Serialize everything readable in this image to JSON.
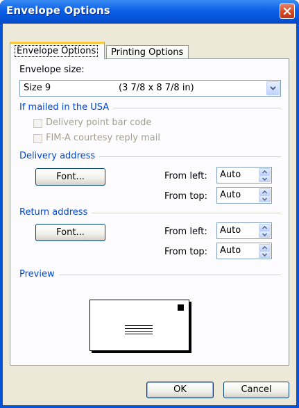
{
  "window": {
    "title": "Envelope Options"
  },
  "tabs": [
    {
      "label": "Envelope Options",
      "active": true
    },
    {
      "label": "Printing Options",
      "active": false
    }
  ],
  "envelope_size": {
    "label": "Envelope size:",
    "selected_name": "Size 9",
    "selected_dims": "(3 7/8 x 8 7/8 in)"
  },
  "usa_group": {
    "label": "If mailed in the USA",
    "delivery_barcode": {
      "label": "Delivery point bar code",
      "checked": false,
      "enabled": false
    },
    "fim_a": {
      "label": "FIM-A courtesy reply mail",
      "checked": false,
      "enabled": false
    }
  },
  "delivery": {
    "label": "Delivery address",
    "font_button": "Font...",
    "from_left_label": "From left:",
    "from_left_value": "Auto",
    "from_top_label": "From top:",
    "from_top_value": "Auto"
  },
  "return": {
    "label": "Return address",
    "font_button": "Font...",
    "from_left_label": "From left:",
    "from_left_value": "Auto",
    "from_top_label": "From top:",
    "from_top_value": "Auto"
  },
  "preview": {
    "label": "Preview"
  },
  "footer": {
    "ok_label": "OK",
    "cancel_label": "Cancel"
  },
  "colors": {
    "title_bar": "#0553d6",
    "group_label": "#0046d5",
    "dialog_bg": "#ece9d8",
    "tab_highlight": "#ffc83c"
  }
}
